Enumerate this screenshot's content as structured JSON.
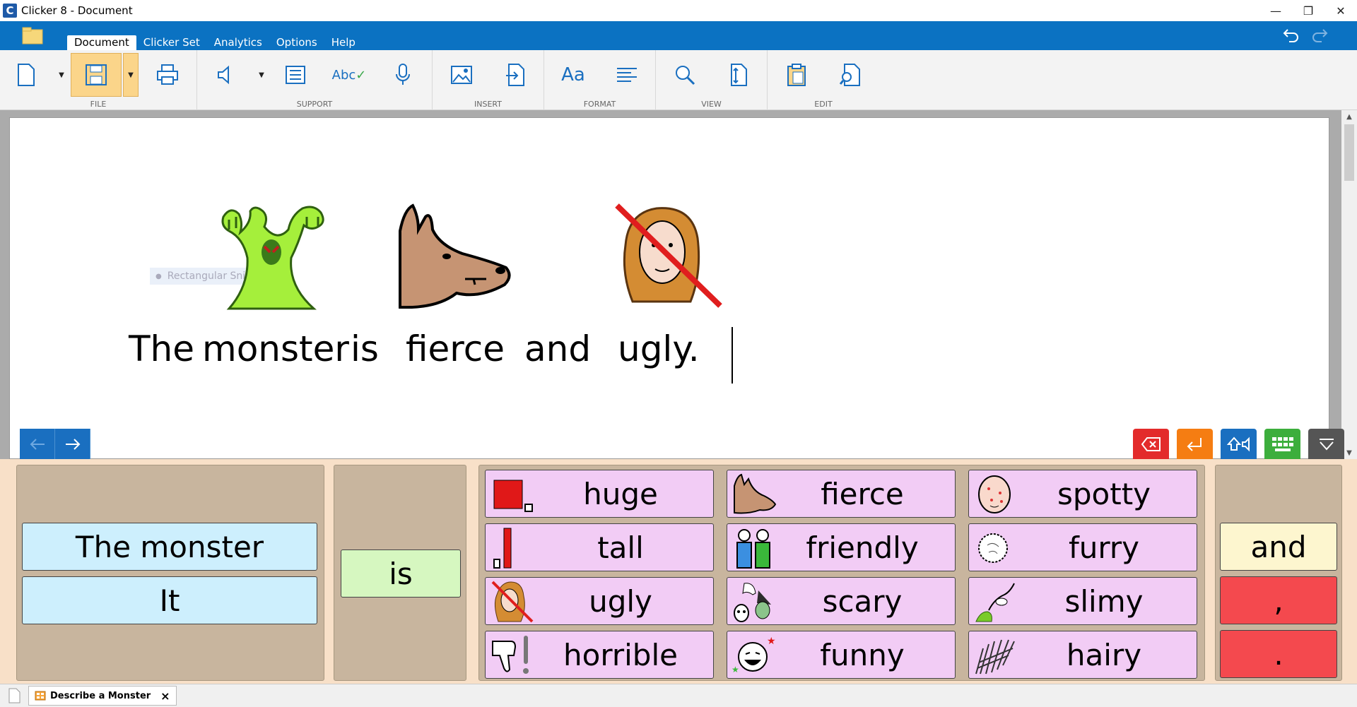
{
  "window": {
    "title": "Clicker 8 - Document"
  },
  "menu": {
    "tabs": [
      {
        "label": "Document"
      },
      {
        "label": "Clicker Set"
      },
      {
        "label": "Analytics"
      },
      {
        "label": "Options"
      },
      {
        "label": "Help"
      }
    ]
  },
  "ribbon": {
    "groups": [
      {
        "label": "FILE"
      },
      {
        "label": "SUPPORT"
      },
      {
        "label": "INSERT"
      },
      {
        "label": "FORMAT"
      },
      {
        "label": "VIEW"
      },
      {
        "label": "EDIT"
      }
    ],
    "format_font_glyph": "Aa",
    "spell_glyph": "Abc"
  },
  "document": {
    "words": [
      "The",
      "monster",
      "is",
      "fierce",
      "and",
      "ugly."
    ],
    "snip_tip": "Rectangular Snip"
  },
  "grid": {
    "subjects": [
      "The monster",
      "It"
    ],
    "verb": "is",
    "adjectives": [
      "huge",
      "fierce",
      "spotty",
      "tall",
      "friendly",
      "furry",
      "ugly",
      "scary",
      "slimy",
      "horrible",
      "funny",
      "hairy"
    ],
    "conjunction": "and",
    "comma": ",",
    "period": "."
  },
  "statusbar": {
    "tab_label": "Describe a Monster",
    "close_glyph": "×"
  },
  "colors": {
    "menubar": "#0b72c2",
    "subject_cell": "#cdeffd",
    "verb_cell": "#d6f7c0",
    "adjective_cell": "#f2ccf5",
    "conjunction_cell": "#fdf6cf",
    "punctuation_cell": "#f4494e",
    "grid_background": "#f8e0c8"
  }
}
